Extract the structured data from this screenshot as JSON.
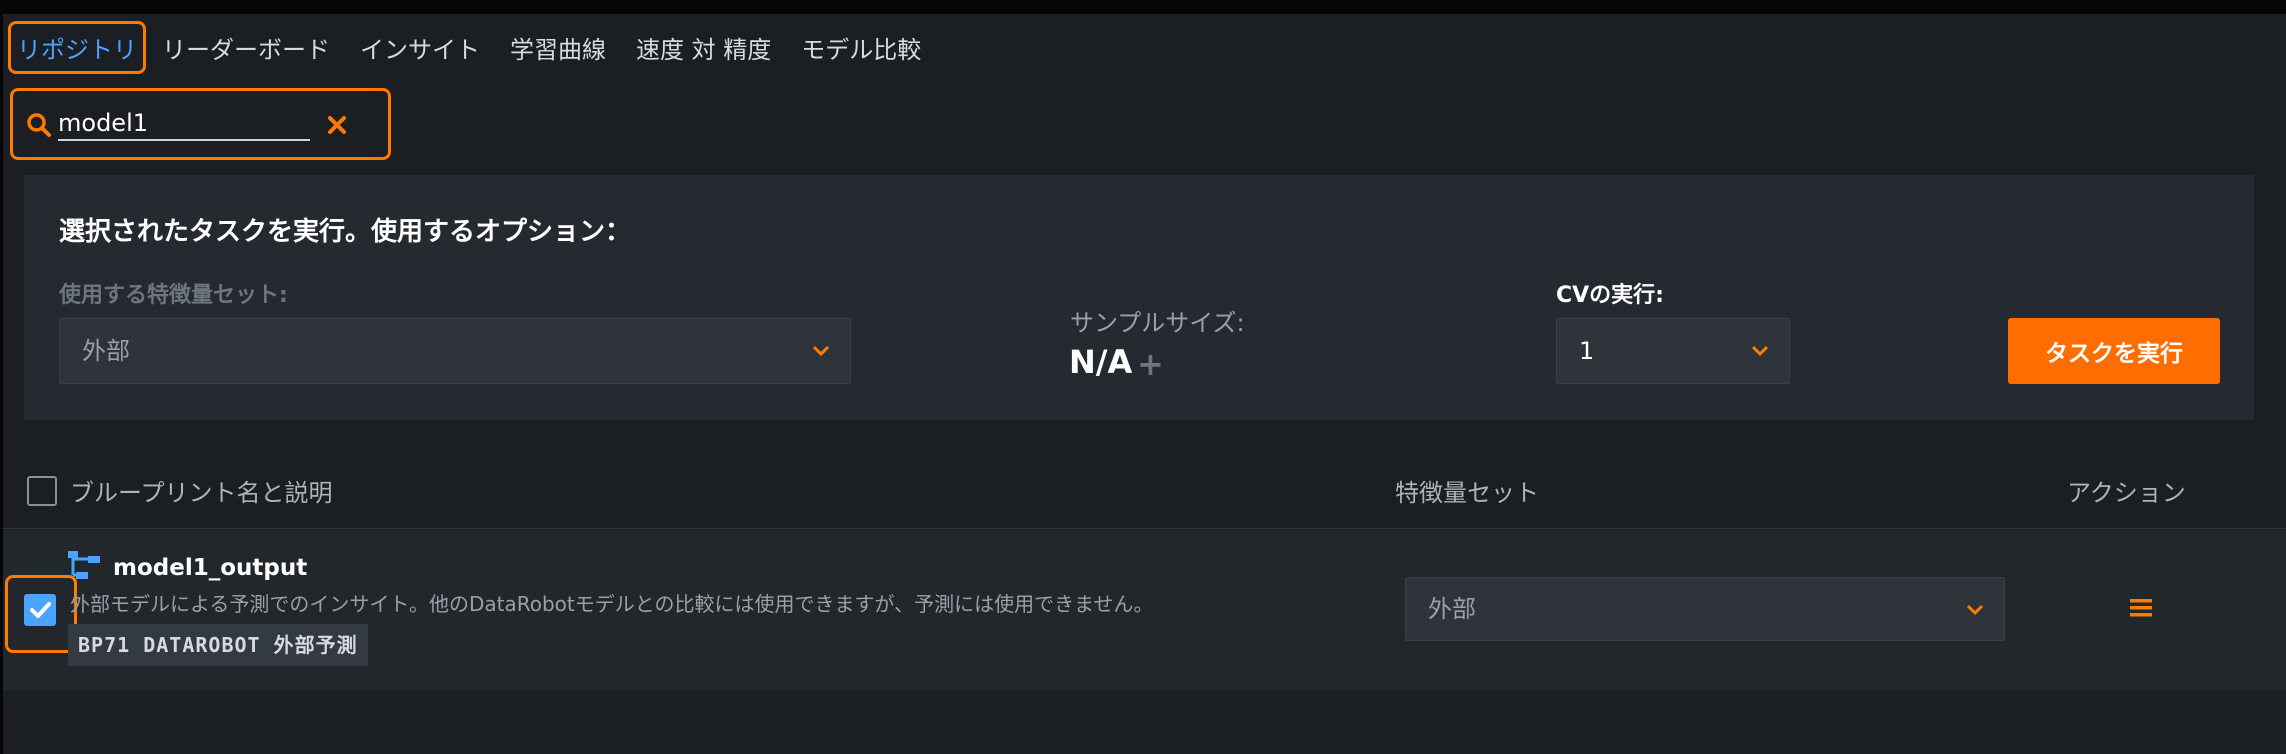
{
  "tabs": [
    {
      "label": "リポジトリ",
      "active": true
    },
    {
      "label": "リーダーボード"
    },
    {
      "label": "インサイト"
    },
    {
      "label": "学習曲線"
    },
    {
      "label": "速度 対 精度"
    },
    {
      "label": "モデル比較"
    }
  ],
  "search": {
    "value": "model1",
    "icon": "search-icon",
    "clear_icon": "close-icon"
  },
  "panel": {
    "title": "選択されたタスクを実行。使用するオプション：",
    "feature_set_label": "使用する特徴量セット:",
    "feature_set_value": "外部",
    "sample_size_label": "サンプルサイズ:",
    "sample_size_value": "N/A",
    "cv_label": "CVの実行:",
    "cv_value": "1",
    "run_button": "タスクを実行"
  },
  "table": {
    "headers": {
      "name": "ブループリント名と説明",
      "feature_set": "特徴量セット",
      "action": "アクション"
    },
    "rows": [
      {
        "name": "model1_output",
        "description": "外部モデルによる予測でのインサイト。他のDataRobotモデルとの比較には使用できますが、予測には使用できません。",
        "badge": "BP71 DATAROBOT 外部予測",
        "feature_set": "外部",
        "checked": true
      }
    ]
  },
  "colors": {
    "accent": "#ff7a00",
    "active_tab": "#4aa3ff",
    "button": "#ff6d00",
    "checkbox": "#4aa3ff"
  }
}
